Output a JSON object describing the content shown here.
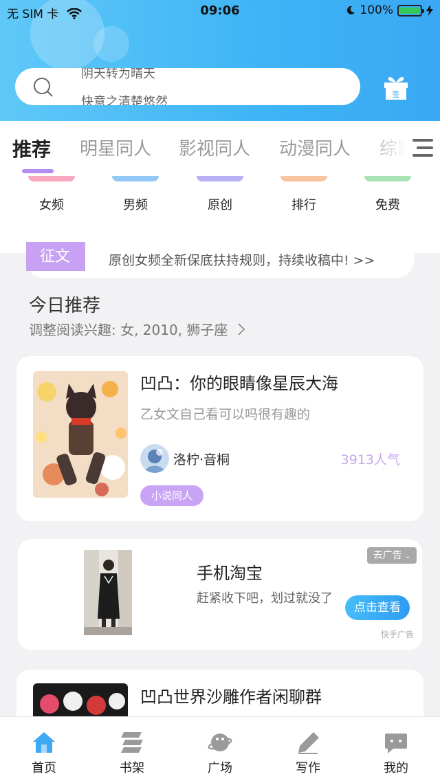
{
  "status_bar": {
    "carrier": "无 SIM 卡",
    "time": "09:06",
    "battery": "100%"
  },
  "search": {
    "line1": "阴天转为晴天",
    "line2": "快意之清楚悠然"
  },
  "gift_label": "签",
  "tabs": [
    "推荐",
    "明星同人",
    "影视同人",
    "动漫同人",
    "综影"
  ],
  "categories": [
    {
      "label": "女频",
      "color": "#f7a9c0"
    },
    {
      "label": "男频",
      "color": "#93c8f7"
    },
    {
      "label": "原创",
      "color": "#b7b0f5"
    },
    {
      "label": "排行",
      "color": "#f8c4a2"
    },
    {
      "label": "免费",
      "color": "#a9e3b5"
    }
  ],
  "notice": {
    "tag": "征文",
    "text": "原创女频全新保底扶持规则，持续收稿中! >>"
  },
  "today": {
    "title": "今日推荐",
    "subtitle": "调整阅读兴趣: 女, 2010, 狮子座"
  },
  "book": {
    "title": "凹凸：你的眼睛像星辰大海",
    "desc": "乙女文自己看可以吗很有趣的",
    "author": "洛柠·音桐",
    "popularity": "3913人气",
    "tag": "小说同人"
  },
  "ad": {
    "title": "手机淘宝",
    "desc": "赶紧收下吧，划过就没了",
    "cta": "点击查看",
    "dismiss": "去广告",
    "source": "快手广告"
  },
  "book2": {
    "title": "凹凸世界沙雕作者闲聊群"
  },
  "nav": [
    "首页",
    "书架",
    "广场",
    "写作",
    "我的"
  ],
  "colors": {
    "accent": "#3fb4f6",
    "purple": "#c8a0f4"
  }
}
